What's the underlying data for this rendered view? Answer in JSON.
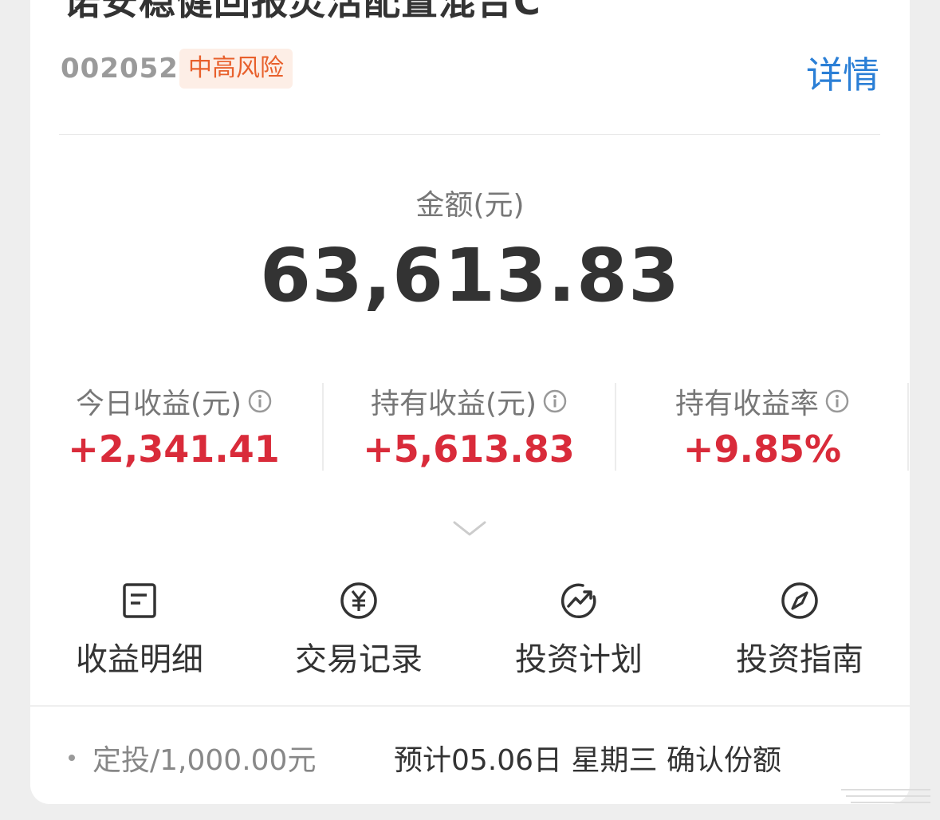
{
  "fund": {
    "title": "诺安稳健回报灵活配置混合C",
    "code": "002052",
    "risk_level": "中高风险",
    "detail_link": "详情"
  },
  "amount": {
    "label": "金额(元)",
    "value": "63,613.83"
  },
  "stats": [
    {
      "label": "今日收益(元)",
      "value": "+2,341.41",
      "icon": "info-icon"
    },
    {
      "label": "持有收益(元)",
      "value": "+5,613.83",
      "icon": "info-icon"
    },
    {
      "label": "持有收益率",
      "value": "+9.85%",
      "icon": "info-icon"
    }
  ],
  "actions": [
    {
      "label": "收益明细",
      "icon": "document-icon"
    },
    {
      "label": "交易记录",
      "icon": "yuan-circle-icon"
    },
    {
      "label": "投资计划",
      "icon": "trend-up-icon"
    },
    {
      "label": "投资指南",
      "icon": "compass-icon"
    }
  ],
  "plan": {
    "text": "定投/1,000.00元",
    "confirm": "预计05.06日 星期三 确认份额"
  },
  "colors": {
    "positive": "#d92b3a",
    "link": "#2b7fd6",
    "risk_text": "#e8602c",
    "risk_bg": "#fdeee6"
  }
}
